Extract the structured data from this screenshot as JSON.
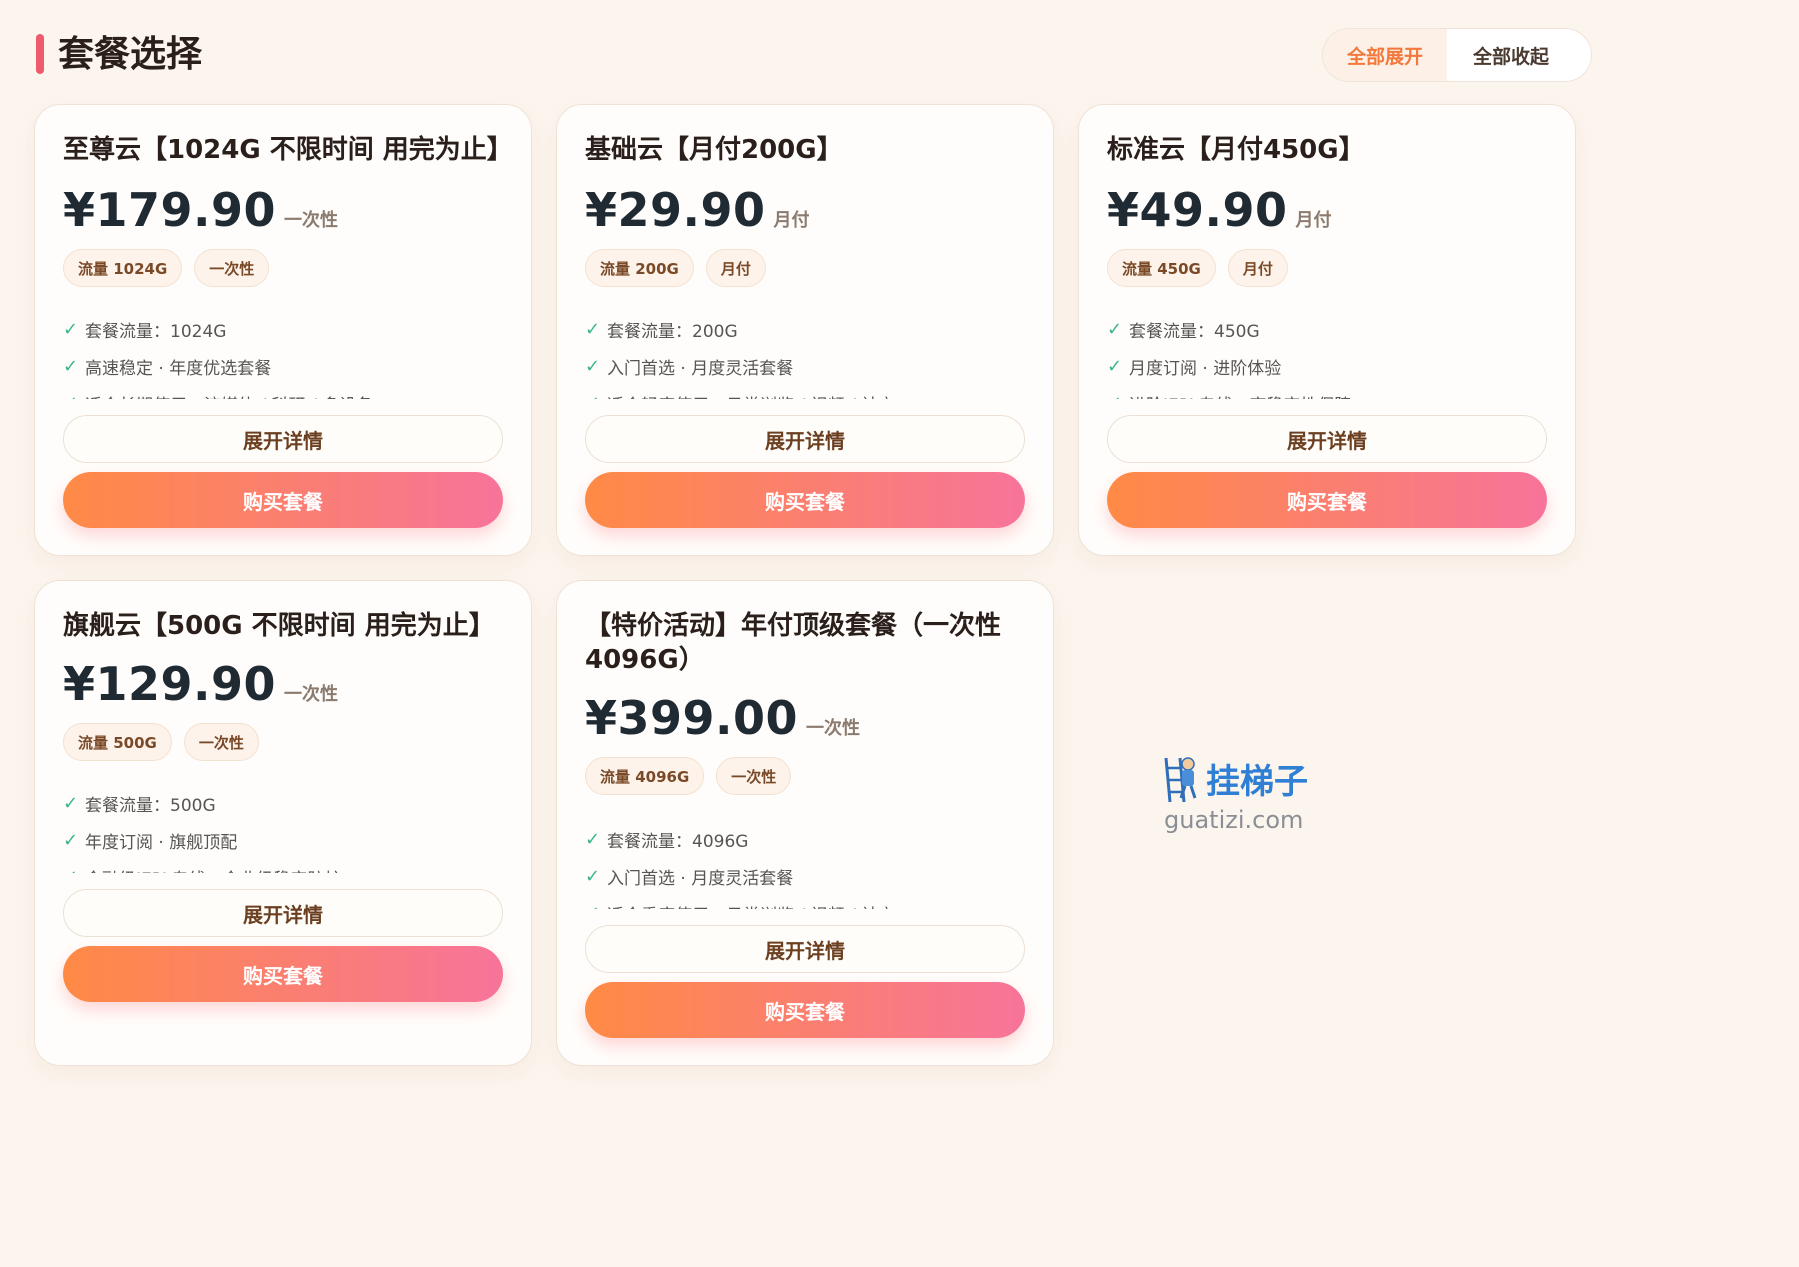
{
  "header": {
    "title": "套餐选择",
    "expand_all": "全部展开",
    "collapse_all": "全部收起"
  },
  "plans": [
    {
      "name": "至尊云【1024G 不限时间 用完为止】",
      "price": "¥179.90",
      "period": "一次性",
      "tags": [
        "流量 1024G",
        "一次性"
      ],
      "features": [
        "套餐流量：1024G",
        "高速稳定 · 年度优选套餐",
        "适合长期使用：流媒体 / 科研 / 多设备"
      ],
      "expand_label": "展开详情",
      "buy_label": "购买套餐"
    },
    {
      "name": "基础云【月付200G】",
      "price": "¥29.90",
      "period": "月付",
      "tags": [
        "流量 200G",
        "月付"
      ],
      "features": [
        "套餐流量：200G",
        "入门首选 · 月度灵活套餐",
        "适合轻度使用：日常浏览 / 视频 / 社交"
      ],
      "expand_label": "展开详情",
      "buy_label": "购买套餐"
    },
    {
      "name": "标准云【月付450G】",
      "price": "¥49.90",
      "period": "月付",
      "tags": [
        "流量 450G",
        "月付"
      ],
      "features": [
        "套餐流量：450G",
        "月度订阅 · 进阶体验",
        "进阶IEPL专线，高稳定性保障"
      ],
      "expand_label": "展开详情",
      "buy_label": "购买套餐"
    },
    {
      "name": "旗舰云【500G 不限时间 用完为止】",
      "price": "¥129.90",
      "period": "一次性",
      "tags": [
        "流量 500G",
        "一次性"
      ],
      "features": [
        "套餐流量：500G",
        "年度订阅 · 旗舰顶配",
        "金融级IEPL专线，企业级稳定防护"
      ],
      "expand_label": "展开详情",
      "buy_label": "购买套餐"
    },
    {
      "name": "【特价活动】年付顶级套餐（一次性4096G）",
      "price": "¥399.00",
      "period": "一次性",
      "tags": [
        "流量 4096G",
        "一次性"
      ],
      "features": [
        "套餐流量：4096G",
        "入门首选 · 月度灵活套餐",
        "适合重度使用：日常浏览 / 视频 / 社交"
      ],
      "expand_label": "展开详情",
      "buy_label": "购买套餐"
    }
  ],
  "watermark": {
    "brand": "挂梯子",
    "domain": "guatizi.com",
    "icon": "ladder-worker-icon"
  },
  "colors": {
    "accent_orange": "#ff8a45",
    "accent_pink": "#f7749a",
    "check_green": "#3db58a",
    "title_bar_red": "#f05a6e"
  }
}
